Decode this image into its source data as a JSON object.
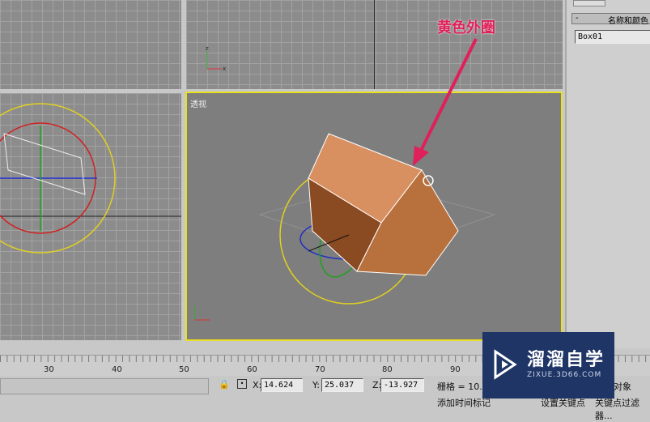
{
  "annotation": {
    "text": "黄色外圈",
    "color": "#e0205a"
  },
  "viewports": {
    "perspective_label": "透视"
  },
  "side_panel": {
    "rollout_title": "名称和颜色",
    "rollout_toggle": "-",
    "object_name": "Box01"
  },
  "timeline": {
    "ticks": [
      "30",
      "40",
      "50",
      "60",
      "70",
      "80",
      "90"
    ]
  },
  "status": {
    "x_label": "X:",
    "x": "14.624",
    "y_label": "Y:",
    "y": "25.037",
    "z_label": "Z:",
    "z": "-13.927",
    "grid": "栅格 = 10.",
    "add_time_tag": "添加时间标记",
    "set_key": "设置关键点",
    "key_filter": "关键点过滤器...",
    "selected": "对象"
  },
  "watermark": {
    "brand": "溜溜自学",
    "url": "ZIXUE.3D66.COM"
  },
  "colors": {
    "selection_border": "#e8e020",
    "box": "#c8824e"
  }
}
